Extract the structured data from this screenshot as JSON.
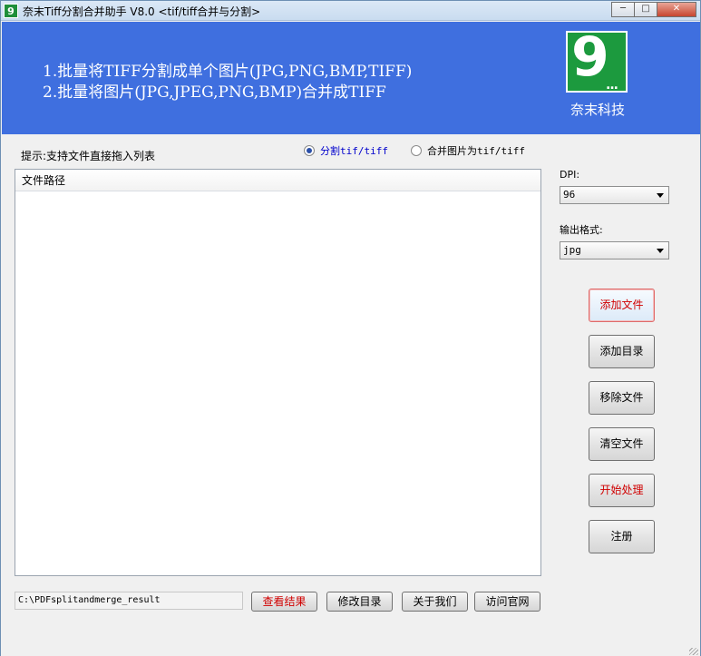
{
  "window": {
    "title": "奈末Tiff分割合并助手 V8.0 <tif/tiff合并与分割>",
    "app_icon": "9",
    "controls": {
      "minimize": "─",
      "maximize": "□",
      "close": "✕"
    }
  },
  "banner": {
    "line1": "1.批量将TIFF分割成单个图片(JPG,PNG,BMP,TIFF)",
    "line2": "2.批量将图片(JPG,JPEG,PNG,BMP)合并成TIFF",
    "logo_text": "9",
    "logo_dots": "...",
    "company": "奈末科技",
    "background": "#3f6fdf",
    "logo_color": "#1c9a3e"
  },
  "hint": "提示:支持文件直接拖入列表",
  "mode": {
    "split_label": "分割tif/tiff",
    "merge_label": "合并图片为tif/tiff",
    "selected": "split"
  },
  "file_list": {
    "column_header": "文件路径",
    "rows": []
  },
  "settings": {
    "dpi_label": "DPI:",
    "dpi_value": "96",
    "format_label": "输出格式:",
    "format_value": "jpg"
  },
  "buttons": {
    "add_file": "添加文件",
    "add_dir": "添加目录",
    "remove_file": "移除文件",
    "clear_files": "清空文件",
    "start": "开始处理",
    "register": "注册"
  },
  "output": {
    "path": "C:\\PDFsplitandmerge_result",
    "view_result": "查看结果",
    "change_dir": "修改目录",
    "about_us": "关于我们",
    "visit_site": "访问官网"
  },
  "colors": {
    "accent_red": "#d00000",
    "selected_blue": "#0000cc"
  }
}
